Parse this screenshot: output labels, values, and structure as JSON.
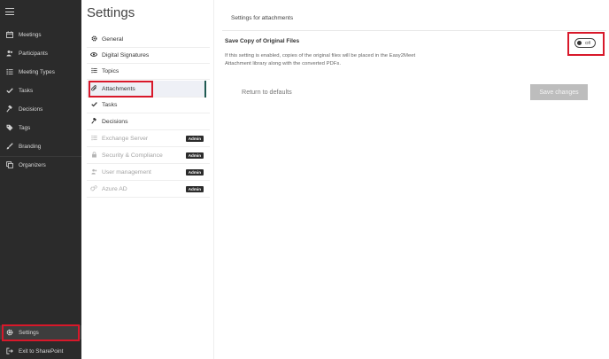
{
  "nav": {
    "items": [
      {
        "label": "Meetings",
        "icon": "calendar-icon"
      },
      {
        "label": "Participants",
        "icon": "participants-icon"
      },
      {
        "label": "Meeting Types",
        "icon": "list-icon"
      },
      {
        "label": "Tasks",
        "icon": "checkmark-icon"
      },
      {
        "label": "Decisions",
        "icon": "gavel-icon"
      },
      {
        "label": "Tags",
        "icon": "tag-icon"
      },
      {
        "label": "Branding",
        "icon": "brush-icon"
      },
      {
        "label": "Organizers",
        "icon": "copy-icon"
      }
    ],
    "settings_label": "Settings",
    "exit_label": "Exit to SharePoint"
  },
  "settings": {
    "title": "Settings",
    "items": [
      {
        "label": "General",
        "icon": "gear-icon"
      },
      {
        "label": "Digital Signatures",
        "icon": "eye-icon"
      },
      {
        "label": "Topics",
        "icon": "list-icon"
      },
      {
        "label": "Attachments",
        "icon": "paperclip-icon"
      },
      {
        "label": "Tasks",
        "icon": "checkmark-icon"
      },
      {
        "label": "Decisions",
        "icon": "gavel-icon"
      },
      {
        "label": "Exchange Server",
        "icon": "list-icon",
        "badge": "Admin"
      },
      {
        "label": "Security & Compliance",
        "icon": "lock-icon",
        "badge": "Admin"
      },
      {
        "label": "User management",
        "icon": "users-icon",
        "badge": "Admin"
      },
      {
        "label": "Azure AD",
        "icon": "gears-icon",
        "badge": "Admin"
      }
    ]
  },
  "main": {
    "header": "Settings for attachments",
    "option_title": "Save Copy of Original Files",
    "option_desc": "If this setting is enabled, copies of the original files will be placed in the Easy2Meet Attachment library along with the converted PDFs.",
    "toggle_label": "Off",
    "return_label": "Return to defaults",
    "save_label": "Save changes"
  },
  "colors": {
    "nav_bg": "#2b2b2b",
    "annotation": "#d8182a",
    "active_bar": "#1f5a52",
    "save_disabled": "#bdbdbd"
  }
}
